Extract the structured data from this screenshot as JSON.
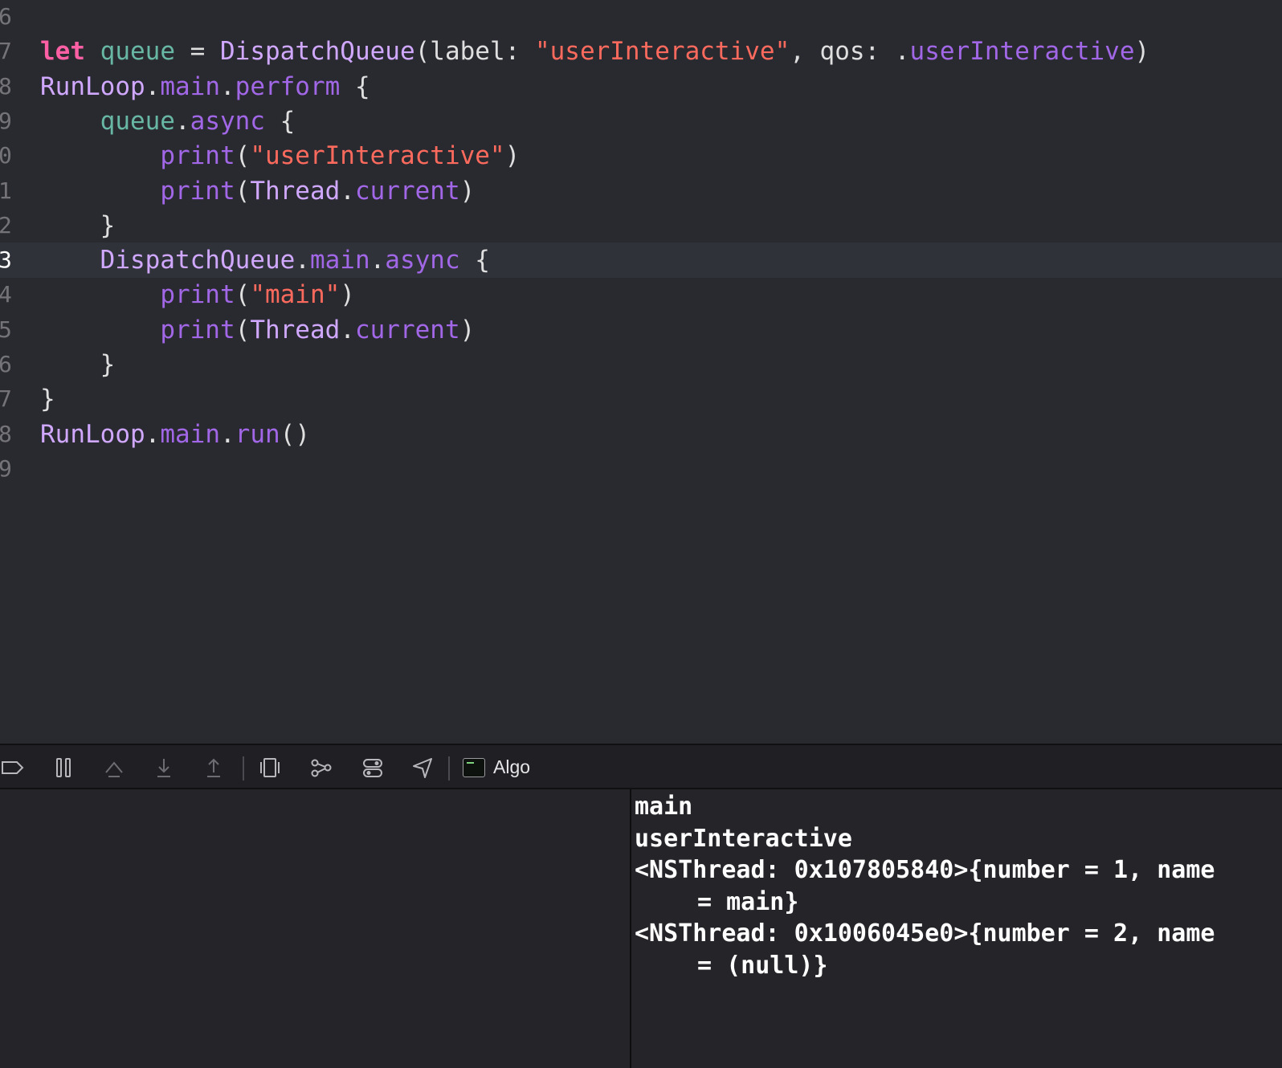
{
  "editor": {
    "lines": [
      {
        "num": "6",
        "code": []
      },
      {
        "num": "7",
        "code": [
          {
            "t": "let",
            "c": "kw"
          },
          {
            "t": " ",
            "c": "plain"
          },
          {
            "t": "queue",
            "c": "var"
          },
          {
            "t": " = ",
            "c": "plain"
          },
          {
            "t": "DispatchQueue",
            "c": "type"
          },
          {
            "t": "(label: ",
            "c": "plain"
          },
          {
            "t": "\"userInteractive\"",
            "c": "str"
          },
          {
            "t": ", qos: .",
            "c": "plain"
          },
          {
            "t": "userInteractive",
            "c": "mem"
          },
          {
            "t": ")",
            "c": "plain"
          }
        ]
      },
      {
        "num": "8",
        "code": [
          {
            "t": "RunLoop",
            "c": "type"
          },
          {
            "t": ".",
            "c": "plain"
          },
          {
            "t": "main",
            "c": "mem"
          },
          {
            "t": ".",
            "c": "plain"
          },
          {
            "t": "perform",
            "c": "mem"
          },
          {
            "t": " {",
            "c": "plain"
          }
        ]
      },
      {
        "num": "9",
        "code": [
          {
            "t": "    ",
            "c": "plain"
          },
          {
            "t": "queue",
            "c": "var"
          },
          {
            "t": ".",
            "c": "plain"
          },
          {
            "t": "async",
            "c": "mem"
          },
          {
            "t": " {",
            "c": "plain"
          }
        ]
      },
      {
        "num": "0",
        "code": [
          {
            "t": "        ",
            "c": "plain"
          },
          {
            "t": "print",
            "c": "mem"
          },
          {
            "t": "(",
            "c": "plain"
          },
          {
            "t": "\"userInteractive\"",
            "c": "str"
          },
          {
            "t": ")",
            "c": "plain"
          }
        ]
      },
      {
        "num": "1",
        "code": [
          {
            "t": "        ",
            "c": "plain"
          },
          {
            "t": "print",
            "c": "mem"
          },
          {
            "t": "(",
            "c": "plain"
          },
          {
            "t": "Thread",
            "c": "type"
          },
          {
            "t": ".",
            "c": "plain"
          },
          {
            "t": "current",
            "c": "mem"
          },
          {
            "t": ")",
            "c": "plain"
          }
        ]
      },
      {
        "num": "2",
        "code": [
          {
            "t": "    }",
            "c": "plain"
          }
        ]
      },
      {
        "num": "3",
        "current": true,
        "code": [
          {
            "t": "    ",
            "c": "plain"
          },
          {
            "t": "DispatchQueue",
            "c": "type"
          },
          {
            "t": ".",
            "c": "plain"
          },
          {
            "t": "main",
            "c": "mem"
          },
          {
            "t": ".",
            "c": "plain"
          },
          {
            "t": "async",
            "c": "mem"
          },
          {
            "t": " {",
            "c": "plain"
          }
        ]
      },
      {
        "num": "4",
        "code": [
          {
            "t": "        ",
            "c": "plain"
          },
          {
            "t": "print",
            "c": "mem"
          },
          {
            "t": "(",
            "c": "plain"
          },
          {
            "t": "\"main\"",
            "c": "str"
          },
          {
            "t": ")",
            "c": "plain"
          }
        ]
      },
      {
        "num": "5",
        "code": [
          {
            "t": "        ",
            "c": "plain"
          },
          {
            "t": "print",
            "c": "mem"
          },
          {
            "t": "(",
            "c": "plain"
          },
          {
            "t": "Thread",
            "c": "type"
          },
          {
            "t": ".",
            "c": "plain"
          },
          {
            "t": "current",
            "c": "mem"
          },
          {
            "t": ")",
            "c": "plain"
          }
        ]
      },
      {
        "num": "6",
        "code": [
          {
            "t": "    }",
            "c": "plain"
          }
        ]
      },
      {
        "num": "7",
        "code": [
          {
            "t": "}",
            "c": "plain"
          }
        ]
      },
      {
        "num": "8",
        "code": [
          {
            "t": "RunLoop",
            "c": "type"
          },
          {
            "t": ".",
            "c": "plain"
          },
          {
            "t": "main",
            "c": "mem"
          },
          {
            "t": ".",
            "c": "plain"
          },
          {
            "t": "run",
            "c": "mem"
          },
          {
            "t": "()",
            "c": "plain"
          }
        ]
      },
      {
        "num": "9",
        "code": []
      }
    ]
  },
  "debug_bar": {
    "buttons": [
      {
        "name": "breakpoints-toggle-icon"
      },
      {
        "name": "pause-icon"
      },
      {
        "name": "step-over-icon"
      },
      {
        "name": "step-into-icon"
      },
      {
        "name": "step-out-icon"
      },
      {
        "name": "debug-view-hierarchy-icon"
      },
      {
        "name": "memory-graph-icon"
      },
      {
        "name": "environment-overrides-icon"
      },
      {
        "name": "simulate-location-icon"
      }
    ],
    "target_name": "Algo"
  },
  "console": {
    "lines": [
      {
        "text": "main"
      },
      {
        "text": "userInteractive"
      },
      {
        "text": "<NSThread: 0x107805840>{number = 1, name"
      },
      {
        "text": "= main}",
        "cont": true
      },
      {
        "text": "<NSThread: 0x1006045e0>{number = 2, name"
      },
      {
        "text": "= (null)}",
        "cont": true
      }
    ]
  },
  "colors": {
    "background": "#292a30",
    "keyword": "#fc5fa3",
    "string": "#fc6a5d",
    "type": "#d0a8ff",
    "variable": "#67b7a4",
    "member": "#a167e6"
  }
}
